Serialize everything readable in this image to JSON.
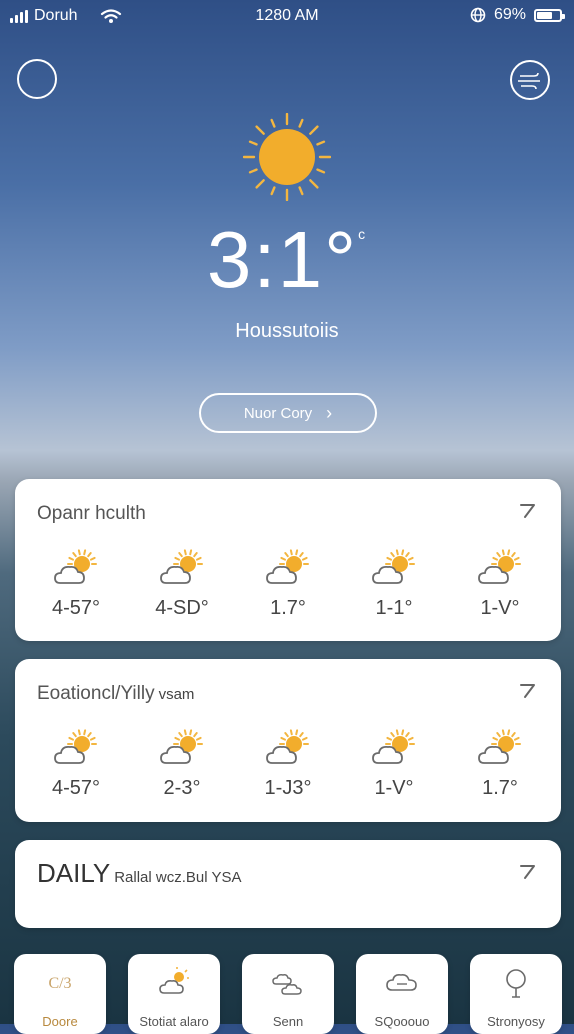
{
  "status_bar": {
    "carrier": "Doruh",
    "time": "1280 AM",
    "battery": "69%",
    "battery_level": 0.69
  },
  "hero": {
    "temperature": "3:1°",
    "unit": "c",
    "condition": "Houssutoiis",
    "more_button": "Nuor Cory",
    "more_chevron": "›"
  },
  "cards": [
    {
      "title": "Opanr hculth",
      "title_small": "",
      "items": [
        {
          "icon": "partly-sunny-icon",
          "temp": "4-57°"
        },
        {
          "icon": "partly-sunny-icon",
          "temp": "4-SD°"
        },
        {
          "icon": "partly-sunny-icon",
          "temp": "1.7°"
        },
        {
          "icon": "partly-sunny-icon",
          "temp": "1-1°"
        },
        {
          "icon": "partly-sunny-icon",
          "temp": "1-V°"
        }
      ]
    },
    {
      "title": "Eoationcl/Yilly",
      "title_small": "vsam",
      "items": [
        {
          "icon": "partly-sunny-icon",
          "temp": "4-57°"
        },
        {
          "icon": "partly-sunny-icon",
          "temp": "2-3°"
        },
        {
          "icon": "partly-sunny-icon",
          "temp": "1-J3°"
        },
        {
          "icon": "partly-sunny-icon",
          "temp": "1-V°"
        },
        {
          "icon": "partly-sunny-icon",
          "temp": "1.7°"
        }
      ]
    },
    {
      "title": "DAILY",
      "title_small": "Rallal wcz.Bul YSA",
      "items": []
    }
  ],
  "tiles": [
    {
      "icon": "gauge-icon",
      "label": "Doore"
    },
    {
      "icon": "sun-cloud-icon",
      "label": "Stotiat alaro"
    },
    {
      "icon": "clouds-icon",
      "label": "Senn"
    },
    {
      "icon": "cloud-chat-icon",
      "label": "SQooouo"
    },
    {
      "icon": "tree-icon",
      "label": "Stronyosy"
    }
  ],
  "colors": {
    "sun": "#f2ad2c",
    "sun_ray": "#f3b640",
    "cloud_stroke": "#6b6b6b",
    "card_text": "#444444"
  }
}
